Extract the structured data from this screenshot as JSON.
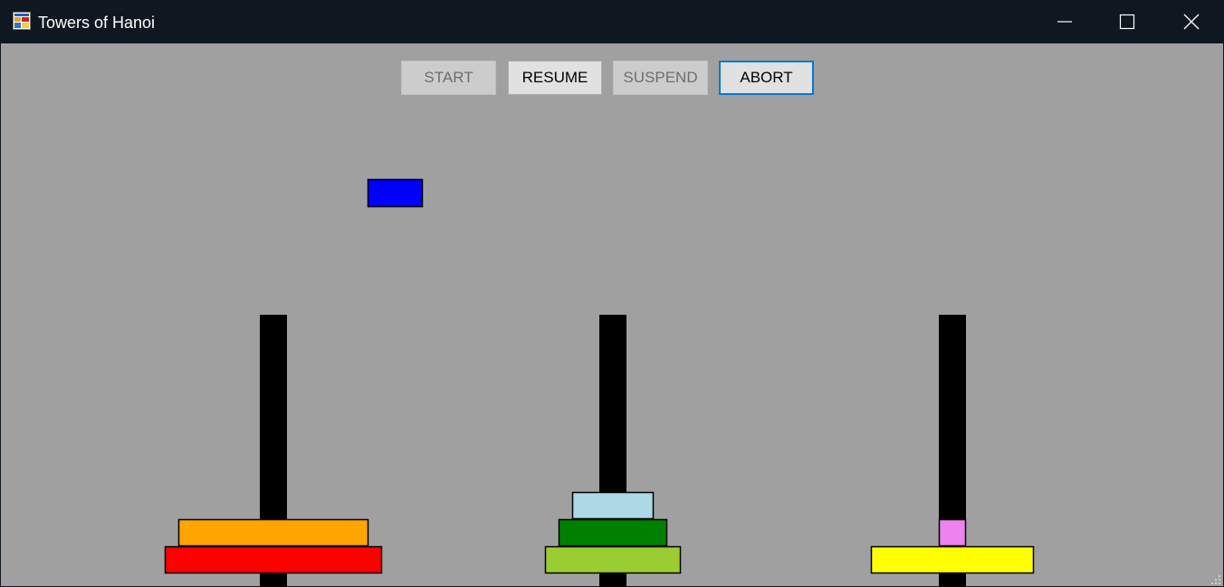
{
  "window": {
    "title": "Towers of Hanoi",
    "icon": "app-window-icon",
    "controls": [
      "minimize-icon",
      "maximize-icon",
      "close-icon"
    ]
  },
  "toolbar": {
    "start_label": "START",
    "resume_label": "RESUME",
    "suspend_label": "SUSPEND",
    "abort_label": "ABORT",
    "states": {
      "start": "disabled",
      "resume": "enabled",
      "suspend": "disabled",
      "abort": "focused"
    }
  },
  "colors": {
    "background": "#a0a0a0",
    "titlebar": "#0f1720",
    "peg": "#000000",
    "focus_border": "#0078d7"
  },
  "game": {
    "pegs": [
      {
        "name": "peg-1",
        "disks": [
          {
            "color": "#ff0000",
            "size": 8
          },
          {
            "color": "#ffa500",
            "size": 7
          }
        ]
      },
      {
        "name": "peg-2",
        "disks": [
          {
            "color": "#9acd32",
            "size": 5
          },
          {
            "color": "#008000",
            "size": 4
          },
          {
            "color": "#add8e6",
            "size": 3
          }
        ]
      },
      {
        "name": "peg-3",
        "disks": [
          {
            "color": "#ffff00",
            "size": 6
          },
          {
            "color": "#ee82ee",
            "size": 1
          }
        ]
      }
    ],
    "moving_disk": {
      "color": "#0000ff",
      "size": 2
    }
  }
}
